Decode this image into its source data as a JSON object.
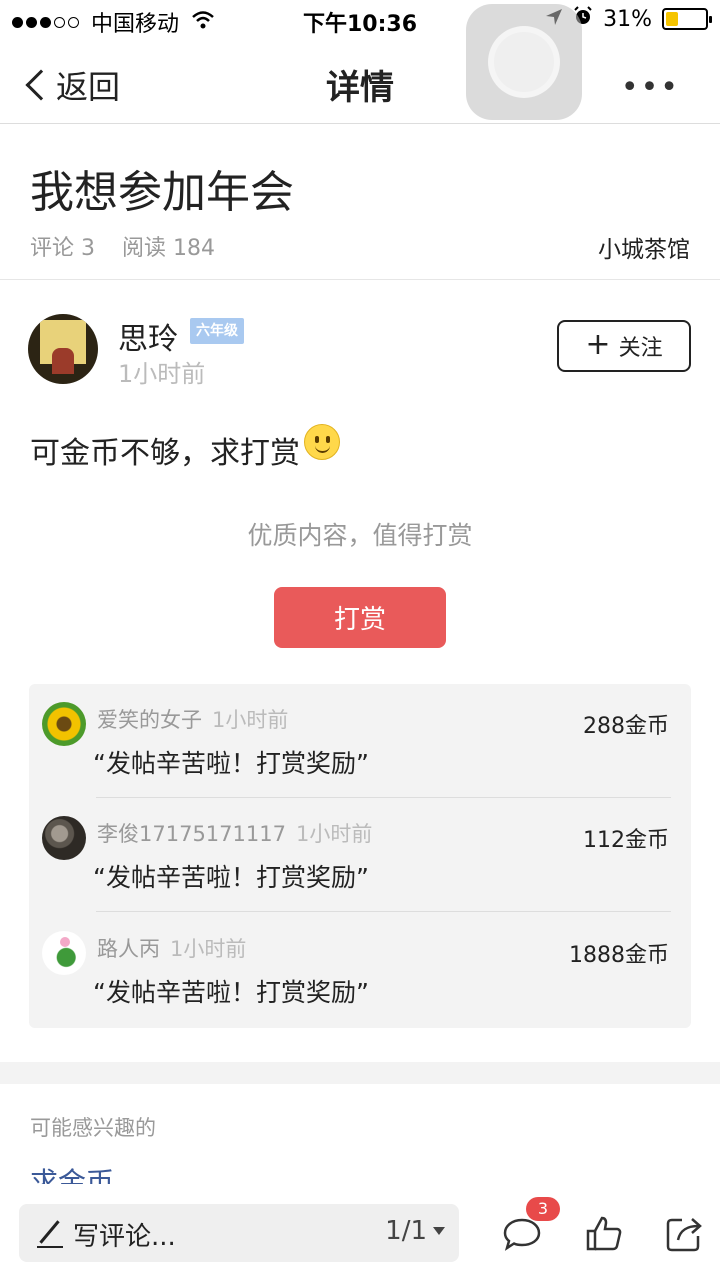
{
  "status_bar": {
    "carrier": "中国移动",
    "time": "下午10:36",
    "battery_percent": "31%",
    "battery_level": 0.31
  },
  "nav": {
    "back_label": "返回",
    "title": "详情",
    "more_label": "•••"
  },
  "post": {
    "title": "我想参加年会",
    "comments_label": "评论 3",
    "reads_label": "阅读 184",
    "forum": "小城茶馆"
  },
  "author": {
    "name": "思玲",
    "level_badge": "六年级",
    "time": "1小时前",
    "follow_label": "关注"
  },
  "content": {
    "text": "可金币不够，求打赏",
    "emoji": "smile-emoji"
  },
  "reward": {
    "hint": "优质内容，值得打赏",
    "button_label": "打赏",
    "items": [
      {
        "name": "爱笑的女子",
        "time": "1小时前",
        "amount": "288金币",
        "message": "“发帖辛苦啦！打赏奖励”"
      },
      {
        "name": "李俊17175171117",
        "time": "1小时前",
        "amount": "112金币",
        "message": "“发帖辛苦啦！打赏奖励”"
      },
      {
        "name": "路人丙",
        "time": "1小时前",
        "amount": "1888金币",
        "message": "“发帖辛苦啦！打赏奖励”"
      }
    ]
  },
  "interest": {
    "label": "可能感兴趣的",
    "first_link": "求金币"
  },
  "toolbar": {
    "comment_placeholder": "写评论...",
    "page_indicator": "1/1",
    "comment_count": "3"
  },
  "colors": {
    "accent_red": "#e95a5a",
    "badge_blue": "#a9c9f0",
    "link_blue": "#3b5998"
  }
}
